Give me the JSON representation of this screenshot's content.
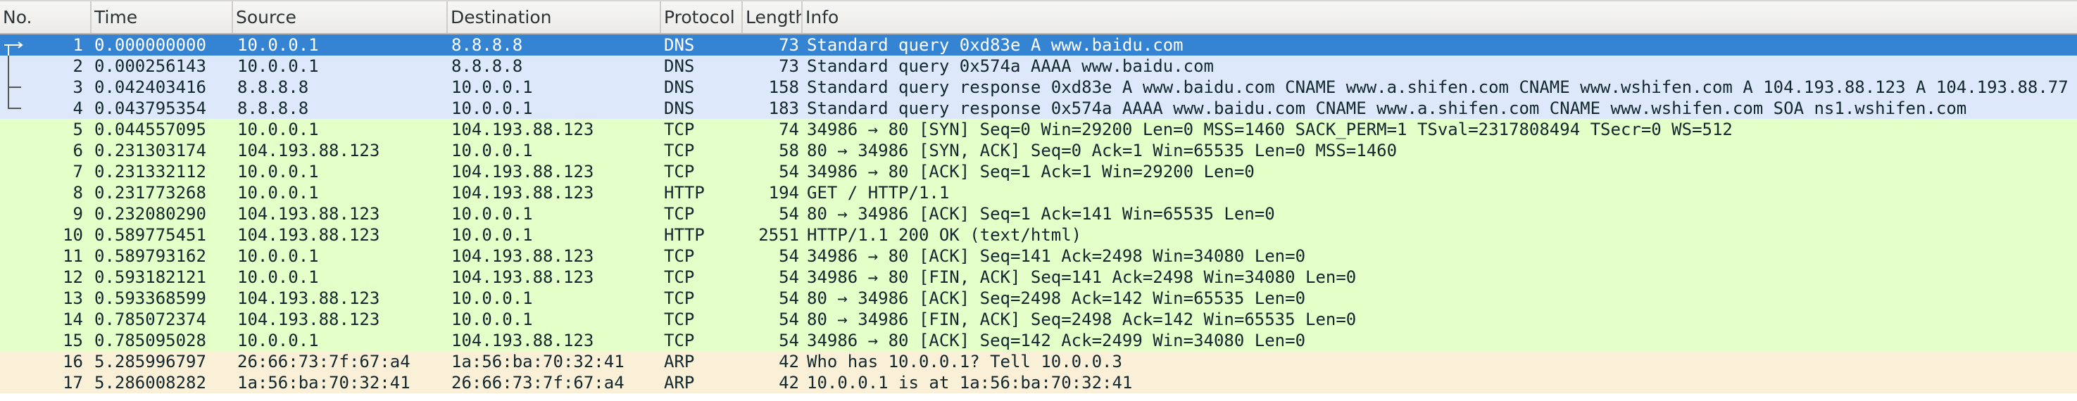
{
  "columns": {
    "no": "No.",
    "time": "Time",
    "source": "Source",
    "destination": "Destination",
    "protocol": "Protocol",
    "length": "Length",
    "info": "Info"
  },
  "packets": [
    {
      "no": "1",
      "time": "0.000000000",
      "source": "10.0.0.1",
      "destination": "8.8.8.8",
      "protocol": "DNS",
      "length": "73",
      "info": "Standard query 0xd83e A www.baidu.com",
      "style": "selected"
    },
    {
      "no": "2",
      "time": "0.000256143",
      "source": "10.0.0.1",
      "destination": "8.8.8.8",
      "protocol": "DNS",
      "length": "73",
      "info": "Standard query 0x574a AAAA www.baidu.com",
      "style": "dns"
    },
    {
      "no": "3",
      "time": "0.042403416",
      "source": "8.8.8.8",
      "destination": "10.0.0.1",
      "protocol": "DNS",
      "length": "158",
      "info": "Standard query response 0xd83e A www.baidu.com CNAME www.a.shifen.com CNAME www.wshifen.com A 104.193.88.123 A 104.193.88.77",
      "style": "dns"
    },
    {
      "no": "4",
      "time": "0.043795354",
      "source": "8.8.8.8",
      "destination": "10.0.0.1",
      "protocol": "DNS",
      "length": "183",
      "info": "Standard query response 0x574a AAAA www.baidu.com CNAME www.a.shifen.com CNAME www.wshifen.com SOA ns1.wshifen.com",
      "style": "dns"
    },
    {
      "no": "5",
      "time": "0.044557095",
      "source": "10.0.0.1",
      "destination": "104.193.88.123",
      "protocol": "TCP",
      "length": "74",
      "info": "34986 → 80 [SYN] Seq=0 Win=29200 Len=0 MSS=1460 SACK_PERM=1 TSval=2317808494 TSecr=0 WS=512",
      "style": "tcp"
    },
    {
      "no": "6",
      "time": "0.231303174",
      "source": "104.193.88.123",
      "destination": "10.0.0.1",
      "protocol": "TCP",
      "length": "58",
      "info": "80 → 34986 [SYN, ACK] Seq=0 Ack=1 Win=65535 Len=0 MSS=1460",
      "style": "tcp"
    },
    {
      "no": "7",
      "time": "0.231332112",
      "source": "10.0.0.1",
      "destination": "104.193.88.123",
      "protocol": "TCP",
      "length": "54",
      "info": "34986 → 80 [ACK] Seq=1 Ack=1 Win=29200 Len=0",
      "style": "tcp"
    },
    {
      "no": "8",
      "time": "0.231773268",
      "source": "10.0.0.1",
      "destination": "104.193.88.123",
      "protocol": "HTTP",
      "length": "194",
      "info": "GET / HTTP/1.1",
      "style": "http"
    },
    {
      "no": "9",
      "time": "0.232080290",
      "source": "104.193.88.123",
      "destination": "10.0.0.1",
      "protocol": "TCP",
      "length": "54",
      "info": "80 → 34986 [ACK] Seq=1 Ack=141 Win=65535 Len=0",
      "style": "tcp"
    },
    {
      "no": "10",
      "time": "0.589775451",
      "source": "104.193.88.123",
      "destination": "10.0.0.1",
      "protocol": "HTTP",
      "length": "2551",
      "info": "HTTP/1.1 200 OK  (text/html)",
      "style": "http"
    },
    {
      "no": "11",
      "time": "0.589793162",
      "source": "10.0.0.1",
      "destination": "104.193.88.123",
      "protocol": "TCP",
      "length": "54",
      "info": "34986 → 80 [ACK] Seq=141 Ack=2498 Win=34080 Len=0",
      "style": "tcp"
    },
    {
      "no": "12",
      "time": "0.593182121",
      "source": "10.0.0.1",
      "destination": "104.193.88.123",
      "protocol": "TCP",
      "length": "54",
      "info": "34986 → 80 [FIN, ACK] Seq=141 Ack=2498 Win=34080 Len=0",
      "style": "tcp"
    },
    {
      "no": "13",
      "time": "0.593368599",
      "source": "104.193.88.123",
      "destination": "10.0.0.1",
      "protocol": "TCP",
      "length": "54",
      "info": "80 → 34986 [ACK] Seq=2498 Ack=142 Win=65535 Len=0",
      "style": "tcp"
    },
    {
      "no": "14",
      "time": "0.785072374",
      "source": "104.193.88.123",
      "destination": "10.0.0.1",
      "protocol": "TCP",
      "length": "54",
      "info": "80 → 34986 [FIN, ACK] Seq=2498 Ack=142 Win=65535 Len=0",
      "style": "tcp"
    },
    {
      "no": "15",
      "time": "0.785095028",
      "source": "10.0.0.1",
      "destination": "104.193.88.123",
      "protocol": "TCP",
      "length": "54",
      "info": "34986 → 80 [ACK] Seq=142 Ack=2499 Win=34080 Len=0",
      "style": "tcp"
    },
    {
      "no": "16",
      "time": "5.285996797",
      "source": "26:66:73:7f:67:a4",
      "destination": "1a:56:ba:70:32:41",
      "protocol": "ARP",
      "length": "42",
      "info": "Who has 10.0.0.1? Tell 10.0.0.3",
      "style": "arp"
    },
    {
      "no": "17",
      "time": "5.286008282",
      "source": "1a:56:ba:70:32:41",
      "destination": "26:66:73:7f:67:a4",
      "protocol": "ARP",
      "length": "42",
      "info": "10.0.0.1 is at 1a:56:ba:70:32:41",
      "style": "arp"
    }
  ],
  "colors": {
    "selected": "#3584d4",
    "dns": "#dde8fa",
    "tcp_http": "#e4ffc7",
    "arp": "#faf0d7"
  },
  "icons": {
    "related_first": "related-request-icon",
    "related_line": "related-line-icon",
    "related_response": "related-response-icon"
  }
}
